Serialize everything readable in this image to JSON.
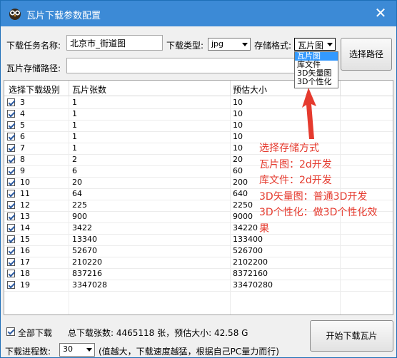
{
  "window": {
    "title": "瓦片下载参数配置"
  },
  "form": {
    "task_name_label": "下载任务名称:",
    "task_name_value": "北京市_街道图",
    "download_type_label": "下载类型:",
    "download_type_value": "jpg",
    "storage_format_label": "存储格式:",
    "storage_format_value": "瓦片图",
    "storage_format_options": [
      "瓦片图",
      "库文件",
      "3D矢量图",
      "3D个性化"
    ],
    "choose_path_button": "选择路径",
    "tile_path_label": "瓦片存储路径:",
    "tile_path_value": ""
  },
  "table": {
    "headers": [
      "选择下载级别",
      "瓦片张数",
      "预估大小"
    ],
    "rows": [
      {
        "level": "3",
        "count": "1",
        "size": "10"
      },
      {
        "level": "4",
        "count": "1",
        "size": "10"
      },
      {
        "level": "5",
        "count": "1",
        "size": "10"
      },
      {
        "level": "6",
        "count": "1",
        "size": "10"
      },
      {
        "level": "7",
        "count": "1",
        "size": "10"
      },
      {
        "level": "8",
        "count": "2",
        "size": "20"
      },
      {
        "level": "9",
        "count": "6",
        "size": "60"
      },
      {
        "level": "10",
        "count": "20",
        "size": "200"
      },
      {
        "level": "11",
        "count": "64",
        "size": "640"
      },
      {
        "level": "12",
        "count": "225",
        "size": "2250"
      },
      {
        "level": "13",
        "count": "900",
        "size": "9000"
      },
      {
        "level": "14",
        "count": "3422",
        "size": "34220"
      },
      {
        "level": "15",
        "count": "13340",
        "size": "133400"
      },
      {
        "level": "16",
        "count": "52670",
        "size": "526700"
      },
      {
        "level": "17",
        "count": "210220",
        "size": "2102200"
      },
      {
        "level": "18",
        "count": "837216",
        "size": "8372160"
      },
      {
        "level": "19",
        "count": "3347028",
        "size": "33470280"
      }
    ]
  },
  "annotation": {
    "lines": [
      "选择存储方式",
      "瓦片图：2d开发",
      "库文件：2d开发",
      "3D矢量图：普通3D开发",
      "3D个性化：做3D个性化效",
      "果"
    ],
    "color": "#e53a2e"
  },
  "bottom": {
    "download_all_label": "全部下载",
    "summary_text": "总下载张数: 4465118 张，预估大小: 42.58 G",
    "progress_label": "下载进程数:",
    "progress_value": "30",
    "progress_hint": "(值越大，下载速度越猛，根据自己PC量力而行)",
    "start_button": "开始下载瓦片"
  },
  "icons": {
    "app_logo": "owl-icon",
    "close": "close-icon",
    "arrow": "red-arrow-icon"
  }
}
